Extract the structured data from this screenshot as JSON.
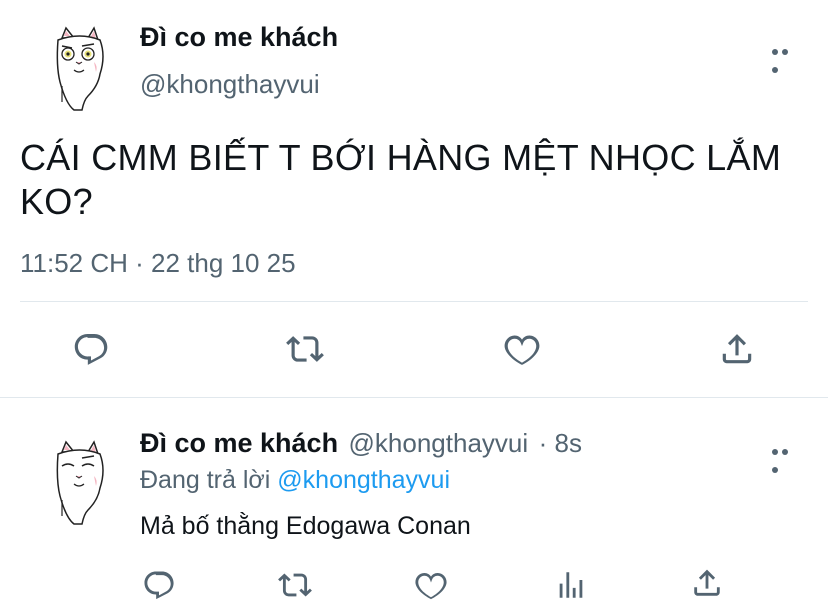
{
  "main_tweet": {
    "display_name": "Đì co me khách",
    "handle": "@khongthayvui",
    "text_line1": "CÁI CMM BIẾT T BỚI HÀNG MỆT NHỌC LẮM",
    "text_line2": "KO?",
    "timestamp": "11:52 CH · 22 thg 10 25",
    "actions": [
      "reply-icon",
      "retweet-icon",
      "like-icon",
      "share-icon"
    ]
  },
  "reply_tweet": {
    "display_name": "Đì co me khách",
    "handle": "@khongthayvui",
    "time_ago": "· 8s",
    "replying_prefix": "Đang trả lời",
    "replying_to": "@khongthayvui",
    "text": "Mả bố thằng Edogawa Conan",
    "actions": [
      "reply-icon",
      "retweet-icon",
      "like-icon",
      "analytics-icon",
      "share-icon"
    ]
  },
  "colors": {
    "text": "#0f1419",
    "secondary": "#536471",
    "link": "#1d9bf0",
    "divider": "#e1e8ed"
  }
}
